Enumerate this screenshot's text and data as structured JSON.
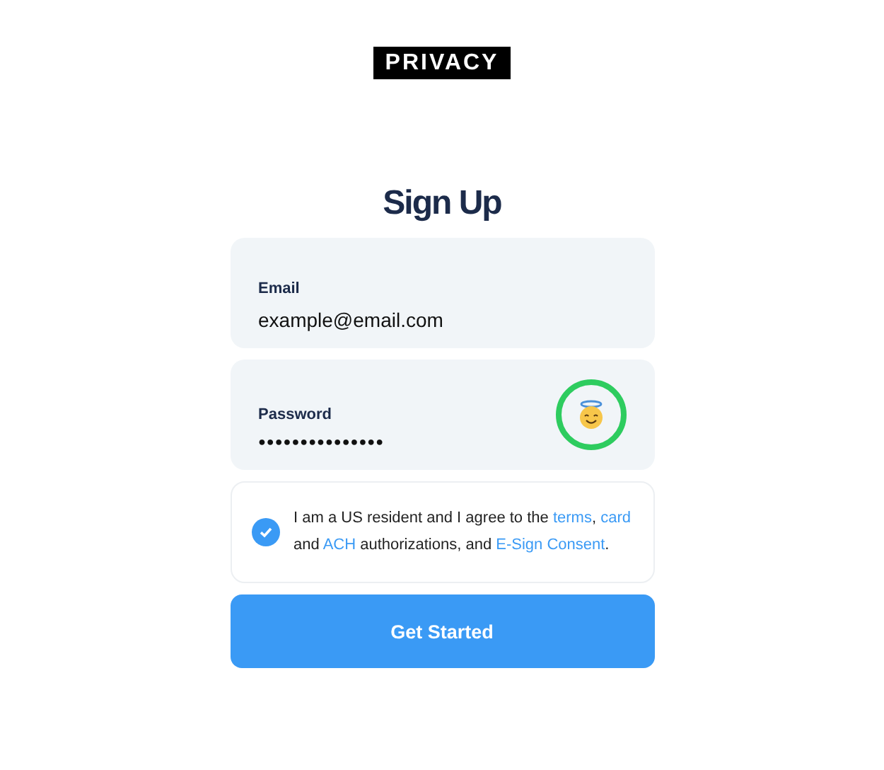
{
  "logo": "PRIVACY",
  "title": "Sign Up",
  "fields": [
    {
      "label": "Email",
      "value": "example@email.com",
      "kind": "text"
    },
    {
      "label": "Password",
      "value": "●●●●●●●●●●●●●●●",
      "kind": "password"
    }
  ],
  "consent": {
    "checked": true,
    "parts": [
      {
        "kind": "text",
        "text": "I am a US resident and I agree to the "
      },
      {
        "kind": "link",
        "text": "terms"
      },
      {
        "kind": "text",
        "text": ", "
      },
      {
        "kind": "link",
        "text": "card"
      },
      {
        "kind": "text",
        "text": " and "
      },
      {
        "kind": "link",
        "text": "ACH"
      },
      {
        "kind": "text",
        "text": " authorizations, and "
      },
      {
        "kind": "link",
        "text": "E-Sign Consent"
      },
      {
        "kind": "text",
        "text": "."
      }
    ]
  },
  "submit": "Get Started"
}
